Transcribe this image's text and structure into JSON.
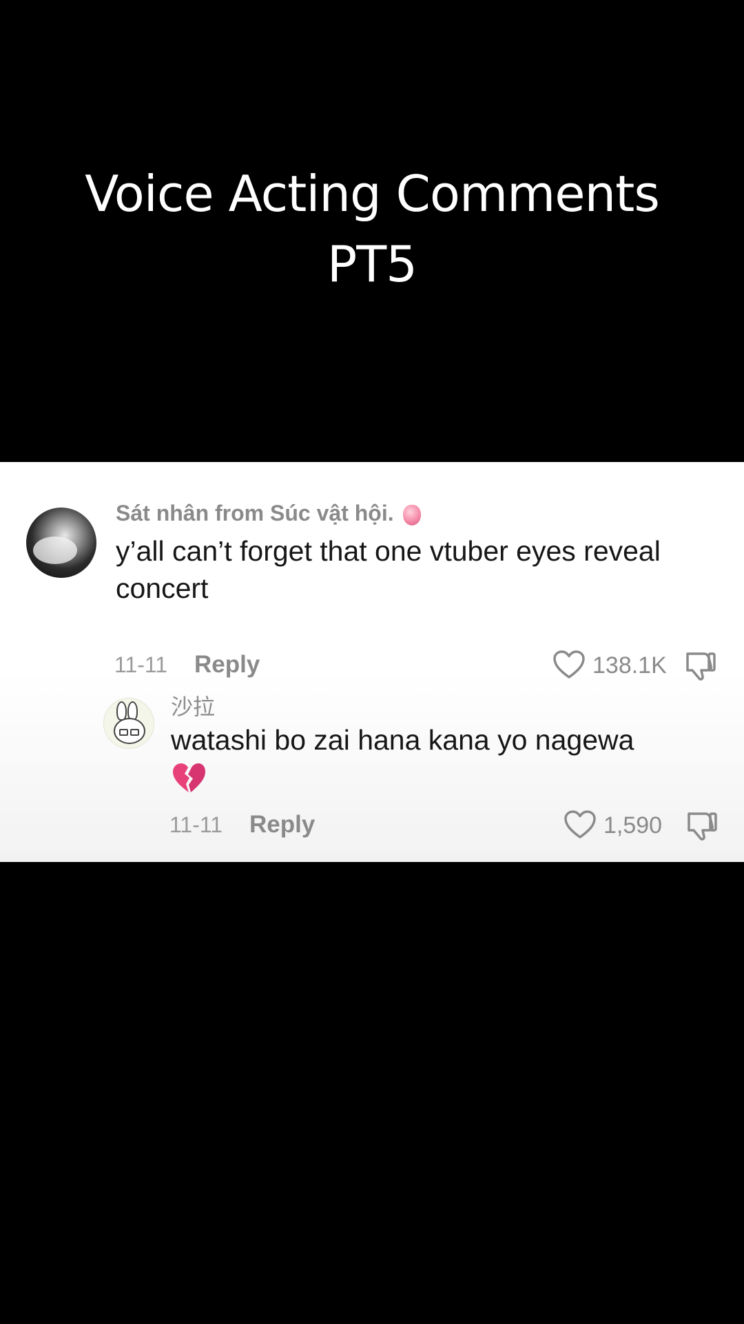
{
  "video": {
    "title_line1": "Voice Acting Comments",
    "title_line2": "PT5"
  },
  "comments": [
    {
      "username": "Sát nhân from Súc vật hội.",
      "username_emoji": "heart-organ-emoji",
      "text": "y’all can’t forget that one vtuber eyes reveal concert",
      "date": "11-11",
      "reply_label": "Reply",
      "likes": "138.1K"
    },
    {
      "username": "沙拉",
      "text": "watashi bo zai hana kana yo nagewa",
      "text_emoji": "broken-heart-emoji",
      "date": "11-11",
      "reply_label": "Reply",
      "likes": "1,590"
    }
  ],
  "colors": {
    "background": "#000000",
    "panel": "#ffffff",
    "username": "#8a8a8a",
    "comment_text": "#161616",
    "meta": "#9a9a9a",
    "broken_heart": "#e8417a"
  }
}
